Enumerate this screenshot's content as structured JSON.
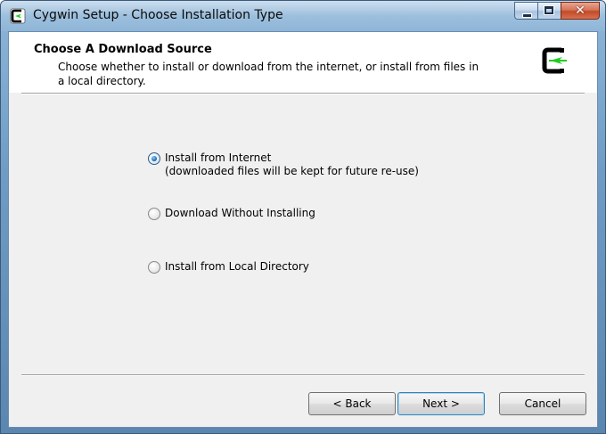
{
  "window": {
    "title": "Cygwin Setup - Choose Installation Type"
  },
  "header": {
    "title": "Choose A Download Source",
    "description": "Choose whether to install or download from the internet, or install from files in a local directory."
  },
  "options": [
    {
      "label_line1": "Install from Internet",
      "label_line2": "(downloaded files will be kept for future re-use)",
      "selected": true
    },
    {
      "label_line1": "Download Without Installing",
      "label_line2": "",
      "selected": false
    },
    {
      "label_line1": "Install from Local Directory",
      "label_line2": "",
      "selected": false
    }
  ],
  "buttons": {
    "back": "< Back",
    "next": "Next >",
    "cancel": "Cancel"
  },
  "icons": {
    "title_icon": "cygwin-logo-icon",
    "header_logo": "cygwin-logo-icon",
    "minimize": "minimize-icon",
    "maximize": "maximize-icon",
    "close": "close-icon"
  },
  "colors": {
    "logo_black": "#000000",
    "logo_green": "#22cc22",
    "selected_radio": "#1e6fb8"
  }
}
